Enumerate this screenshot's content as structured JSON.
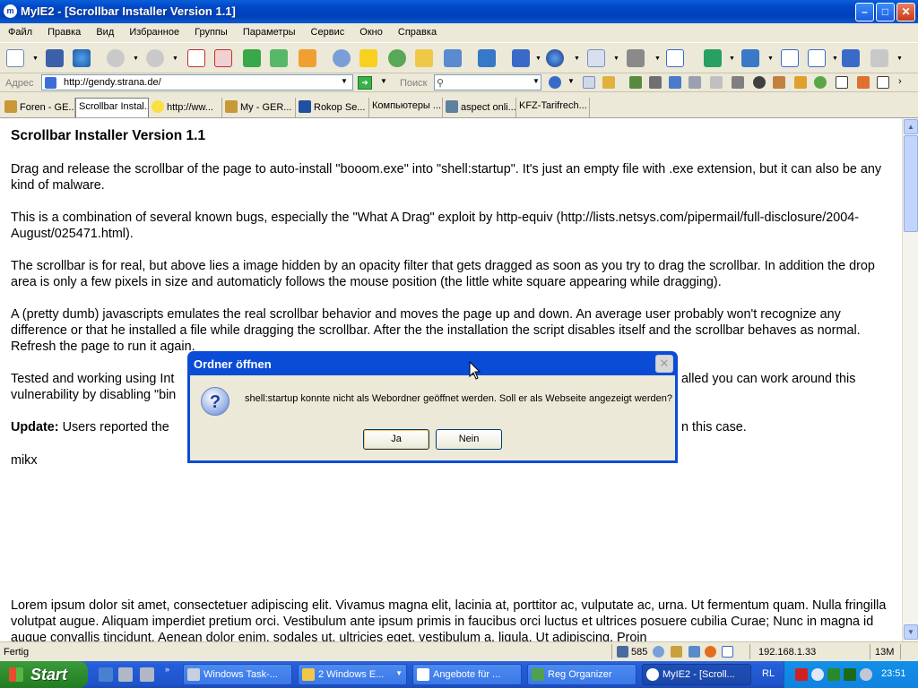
{
  "window": {
    "title": "MyIE2 - [Scrollbar Installer Version 1.1]"
  },
  "menu": [
    "Файл",
    "Правка",
    "Вид",
    "Избранное",
    "Группы",
    "Параметры",
    "Сервис",
    "Окно",
    "Справка"
  ],
  "address": {
    "label": "Адрес",
    "url": "http://gendy.strana.de/",
    "search_label": "Поиск"
  },
  "tabs": [
    "Foren - GE...",
    "Scrollbar Instal...",
    "http://ww...",
    "My - GER...",
    "Rokop Se...",
    "Компьютеры ...",
    "aspect onli...",
    "KFZ-Tarifrech..."
  ],
  "page": {
    "heading": "Scrollbar Installer Version 1.1",
    "p1": "Drag and release the scrollbar of the page to auto-install \"booom.exe\" into \"shell:startup\". It's just an empty file with .exe extension, but it can also be any kind of malware.",
    "p2": "This is a combination of several known bugs, especially the \"What A Drag\" exploit by http-equiv (http://lists.netsys.com/pipermail/full-disclosure/2004-August/025471.html).",
    "p3": "The scrollbar is for real, but above lies a image hidden by an opacity filter that gets dragged as soon as you try to drag the scrollbar. In addition the drop area is only a few pixels in size and automaticly follows the mouse position (the little white square appearing while dragging).",
    "p4": "A (pretty dumb) javascripts emulates the real scrollbar behavior and moves the page up and down. An average user probably won't recognize any difference or that he installed a file while dragging the scrollbar. After the the installation the script disables itself and the scrollbar behaves as normal. Refresh the page to run it again.",
    "p5_left": "Tested and working using Int",
    "p5_right": "alled you can work around this",
    "p5_line2": "vulnerability by disabling \"bin",
    "update_label": "Update:",
    "update_left": "Users reported the",
    "update_right": "n this case.",
    "signature": "mikx",
    "lorem": "Lorem ipsum dolor sit amet, consectetuer adipiscing elit. Vivamus magna elit, lacinia at, porttitor ac, vulputate ac, urna. Ut fermentum quam. Nulla fringilla volutpat augue. Aliquam imperdiet pretium orci. Vestibulum ante ipsum primis in faucibus orci luctus et ultrices posuere cubilia Curae; Nunc in magna id augue convallis tincidunt. Aenean dolor enim, sodales ut, ultricies eget, vestibulum a, ligula. Ut adipiscing. Proin"
  },
  "dialog": {
    "title": "Ordner öffnen",
    "close": "✕",
    "message": "shell:startup konnte nicht als Webordner geöffnet werden. Soll er als Webseite angezeigt werden?",
    "yes": "Ja",
    "no": "Nein",
    "icon": "question-icon"
  },
  "status": {
    "text": "Fertig",
    "count": "585",
    "ip": "192.168.1.33",
    "memory": "13M"
  },
  "taskbar": {
    "start": "Start",
    "tasks": [
      "Windows Task-...",
      "2 Windows E...",
      "Angebote für ...",
      "Reg Organizer",
      "MyIE2 - [Scroll..."
    ],
    "lang": "RL",
    "clock": "23:51"
  }
}
